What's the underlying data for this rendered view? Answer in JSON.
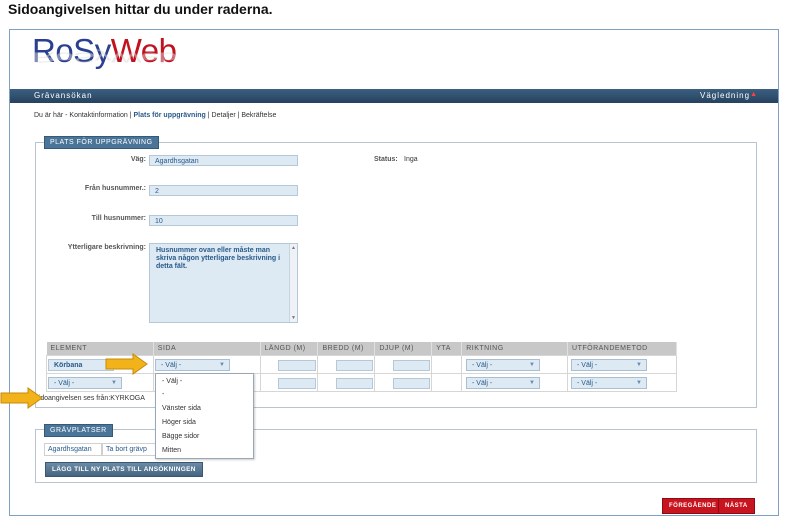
{
  "caption": "Sidoangivelsen hittar du under raderna.",
  "logo": {
    "part1": "RoSy",
    "part2": "Web"
  },
  "navbar": {
    "title": "Grävansökan",
    "help": "Vägledning",
    "help_marker": "▲"
  },
  "breadcrumb": {
    "prefix": "Du är här - Kontaktinformation |",
    "active": "Plats för uppgrävning",
    "suffix": "| Detaljer | Bekräftelse"
  },
  "section_plats": {
    "legend": "PLATS FÖR UPPGRÄVNING",
    "vag_label": "Väg:",
    "vag_value": "Agardhsgatan",
    "fran_label": "Från husnummer.:",
    "fran_value": "2",
    "till_label": "Till husnummer:",
    "till_value": "10",
    "beskr_label": "Ytterligare beskrivning:",
    "beskr_value": "Husnummer ovan eller måste man skriva någon ytterligare beskrivning i detta fält.",
    "status_label": "Status:",
    "status_value": "Inga"
  },
  "table": {
    "headers": [
      "ELEMENT",
      "SIDA",
      "LÄNGD (M)",
      "BREDD (M)",
      "DJUP (M)",
      "YTA",
      "RIKTNING",
      "UTFÖRANDEMETOD"
    ],
    "row1_element": "Körbana",
    "sida_select": "- Välj -",
    "riktning_select": "- Välj -",
    "metod_select": "- Välj -",
    "row2_element_select": "- Välj -"
  },
  "dropdown": {
    "options": [
      "- Välj -",
      "-",
      "Vänster sida",
      "Höger sida",
      "Bägge sidor",
      "Mitten"
    ]
  },
  "hint": "Sidoangivelsen ses från:KYRKOGA",
  "section_grav": {
    "legend": "GRÄVPLATSER",
    "place": "Agardhsgatan",
    "remove": "Ta bort grävp",
    "add_button": "LÄGG TILL NY PLATS TILL ANSÖKNINGEN"
  },
  "footer": {
    "prev": "FÖREGÅENDE",
    "next": "NÄSTA"
  },
  "colors": {
    "accent": "#4a7599",
    "brand_blue": "#2a3f8f",
    "brand_red": "#c1121f",
    "arrow": "#f2b21a",
    "button_red": "#c8141e"
  }
}
